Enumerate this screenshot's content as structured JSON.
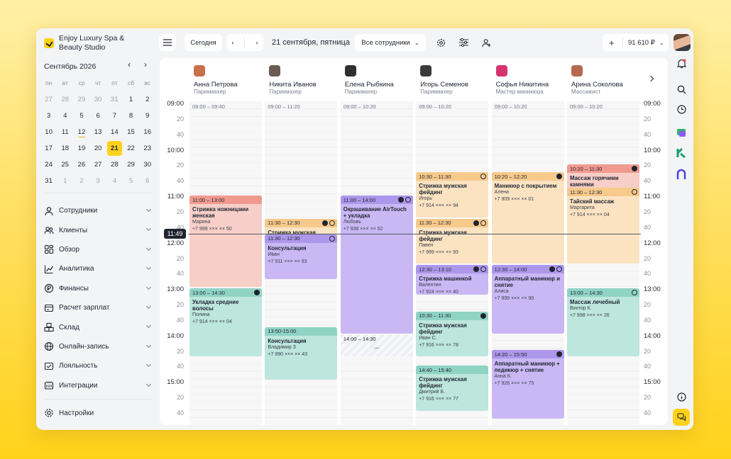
{
  "brand": {
    "name": "Enjoy Luxury Spa & Beauty Studio"
  },
  "mini_calendar": {
    "month_label": "Сентябрь 2026",
    "weekdays": [
      "пн",
      "вт",
      "ср",
      "чт",
      "пт",
      "сб",
      "вс"
    ],
    "days": [
      {
        "d": "27",
        "m": true
      },
      {
        "d": "28",
        "m": true
      },
      {
        "d": "29",
        "m": true
      },
      {
        "d": "30",
        "m": true
      },
      {
        "d": "31",
        "m": true
      },
      {
        "d": "1"
      },
      {
        "d": "2"
      },
      {
        "d": "3"
      },
      {
        "d": "4"
      },
      {
        "d": "5"
      },
      {
        "d": "6"
      },
      {
        "d": "7"
      },
      {
        "d": "8"
      },
      {
        "d": "9"
      },
      {
        "d": "10"
      },
      {
        "d": "11"
      },
      {
        "d": "12",
        "today": true
      },
      {
        "d": "13"
      },
      {
        "d": "14"
      },
      {
        "d": "15"
      },
      {
        "d": "16"
      },
      {
        "d": "17"
      },
      {
        "d": "18"
      },
      {
        "d": "19"
      },
      {
        "d": "20"
      },
      {
        "d": "21",
        "sel": true
      },
      {
        "d": "22"
      },
      {
        "d": "23"
      },
      {
        "d": "24"
      },
      {
        "d": "25"
      },
      {
        "d": "26"
      },
      {
        "d": "27"
      },
      {
        "d": "28"
      },
      {
        "d": "29"
      },
      {
        "d": "30"
      },
      {
        "d": "31"
      },
      {
        "d": "1",
        "m": true
      },
      {
        "d": "2",
        "m": true
      },
      {
        "d": "3",
        "m": true
      },
      {
        "d": "4",
        "m": true
      },
      {
        "d": "5",
        "m": true
      },
      {
        "d": "6",
        "m": true
      }
    ]
  },
  "nav": [
    {
      "label": "Сотрудники",
      "icon": "user-icon"
    },
    {
      "label": "Клиенты",
      "icon": "users-icon"
    },
    {
      "label": "Обзор",
      "icon": "dashboard-icon"
    },
    {
      "label": "Аналитика",
      "icon": "chart-line-icon"
    },
    {
      "label": "Финансы",
      "icon": "coin-icon"
    },
    {
      "label": "Расчет зарплат",
      "icon": "payroll-icon"
    },
    {
      "label": "Склад",
      "icon": "boxes-icon"
    },
    {
      "label": "Онлайн-запись",
      "icon": "globe-icon"
    },
    {
      "label": "Лояльность",
      "icon": "loyalty-icon"
    },
    {
      "label": "Интеграции",
      "icon": "integrations-icon"
    }
  ],
  "settings_label": "Настройки",
  "toolbar": {
    "today": "Сегодня",
    "date": "21 сентября, пятница",
    "staff_filter": "Все сотрудники",
    "balance": "91 610 ₽"
  },
  "staff": [
    {
      "name": "Анна Петрова",
      "role": "Парикмахер",
      "photo": "#c96f4a"
    },
    {
      "name": "Никита Иванов",
      "role": "Парикмахер",
      "photo": "#6b5a52"
    },
    {
      "name": "Елена Рыбкина",
      "role": "Парикмахер",
      "photo": "#2f2f33"
    },
    {
      "name": "Игорь Семенов",
      "role": "Парикмахер",
      "photo": "#3a3a3a"
    },
    {
      "name": "Софья Никитина",
      "role": "Мастер маникюра",
      "photo": "#d6336c"
    },
    {
      "name": "Арина Соколова",
      "role": "Массажист",
      "photo": "#b56a50"
    }
  ],
  "time_labels": [
    "09:00",
    "20",
    "40",
    "10:00",
    "20",
    "40",
    "11:00",
    "20",
    "40",
    "12:00",
    "20",
    "40",
    "13:00",
    "20",
    "40",
    "14:00",
    "20",
    "40",
    "15:00",
    "20",
    "40"
  ],
  "current_time": "11:49",
  "columns": [
    {
      "free": "09:00 – 09:40",
      "appts": [
        {
          "time": "11:00 – 13:00",
          "title": "Стрижка ножницами женская",
          "client": "Марина",
          "phone": "+7 999 ××× ×× 50",
          "color": "red",
          "start": 660,
          "end": 780,
          "badges": []
        },
        {
          "time": "13:00 – 14:30",
          "title": "Укладка средние волосы",
          "client": "Полина",
          "phone": "+7 914 ××× ×× 04",
          "color": "teal",
          "start": 780,
          "end": 870,
          "badges": [
            "dot"
          ]
        }
      ]
    },
    {
      "free": "09:00 – 11:20",
      "appts": [
        {
          "time": "11:30 – 12:30",
          "title": "Стрижка мужская фейдинг",
          "client": "Валентин",
          "phone": "+7 924 ××× ×× 40",
          "color": "ora",
          "start": 690,
          "end": 750,
          "badges": [
            "dot",
            "web"
          ]
        },
        {
          "time": "11:30 – 12:30",
          "title": "Консультация",
          "client": "Иван",
          "phone": "+7 911 ××× ×× 93",
          "color": "pur",
          "start": 710,
          "end": 770,
          "badges": [
            "web"
          ]
        },
        {
          "time": "13:50-15:00",
          "title": "Консультация",
          "client": "Владимир З",
          "phone": "+7 990 ××× ×× 43",
          "color": "teal",
          "start": 830,
          "end": 900,
          "badges": []
        }
      ]
    },
    {
      "free": "09:00 – 10:20",
      "appts": [
        {
          "time": "11:00 – 14:00",
          "title": "Окрашивание AirTouch + укладка",
          "client": "Любовь",
          "phone": "+7 936 ××× ×× 52",
          "color": "pur",
          "start": 660,
          "end": 840,
          "badges": [
            "dot",
            "web"
          ]
        },
        {
          "time": "14:00 – 14:30",
          "title": "",
          "client": "",
          "phone": "",
          "more": "···",
          "color": "hatch",
          "start": 840,
          "end": 870,
          "badges": []
        }
      ]
    },
    {
      "free": "09:00 – 10:20",
      "appts": [
        {
          "time": "10:30 – 11:30",
          "title": "Стрижка мужская фейдинг",
          "client": "Игорь",
          "phone": "+7 914 ××× ×× 94",
          "color": "ora",
          "start": 630,
          "end": 690,
          "badges": [
            "web"
          ]
        },
        {
          "time": "11:30 – 12:30",
          "title": "Стрижка мужская фейдинг",
          "client": "Павел",
          "phone": "+7 999 ××× ×× 93",
          "color": "ora",
          "start": 690,
          "end": 750,
          "badges": [
            "dot",
            "web"
          ]
        },
        {
          "time": "12:30 – 13:10",
          "title": "Стрижка машинкой",
          "client": "Валентин",
          "phone": "+7 924 ××× ×× 40",
          "color": "pur",
          "start": 750,
          "end": 790,
          "badges": [
            "dot",
            "web"
          ]
        },
        {
          "time": "10:30 – 11:30",
          "title": "Стрижка мужская фейдинг",
          "client": "Иван С.",
          "phone": "+7 916 ××× ×× 78",
          "color": "teal",
          "start": 810,
          "end": 870,
          "badges": [
            "dot"
          ]
        },
        {
          "time": "14:40 – 15:40",
          "title": "Стрижка мужская фейдинг",
          "client": "Дмитрий Б.",
          "phone": "+7 916 ××× ×× 77",
          "color": "teal",
          "start": 880,
          "end": 940,
          "badges": []
        }
      ]
    },
    {
      "free": "09:00 – 10:20",
      "appts": [
        {
          "time": "10:20 – 12:20",
          "title": "Маникюр с покрытием",
          "client": "Алена",
          "phone": "+7 909 ××× ×× 01",
          "color": "ora",
          "start": 630,
          "end": 750,
          "badges": [
            "dot"
          ]
        },
        {
          "time": "12:30 – 14:00",
          "title": "Аппаратный маникюр и снятие",
          "client": "Алиса",
          "phone": "+7 999 ××× ×× 90",
          "color": "pur",
          "start": 750,
          "end": 840,
          "badges": [
            "dot",
            "web"
          ]
        },
        {
          "time": "14:20 – 15:50",
          "title": "Аппаратный маникюр + педикюр + снятие",
          "client": "Анна К.",
          "phone": "+7 926 ××× ×× 75",
          "color": "pur",
          "start": 860,
          "end": 950,
          "badges": [
            "dot"
          ]
        }
      ]
    },
    {
      "free": "09:00 – 10:20",
      "appts": [
        {
          "time": "10:20 – 11:30",
          "title": "Массаж горячими камнями",
          "client": "Вячеслав",
          "phone": "+7 909 ××× ×× 04",
          "color": "red",
          "start": 620,
          "end": 690,
          "badges": [
            "dot"
          ]
        },
        {
          "time": "11:30 – 12:30",
          "title": "Тайский массаж",
          "client": "Маргарита",
          "phone": "+7 914 ××× ×× 04",
          "color": "ora",
          "start": 650,
          "end": 750,
          "badges": [
            "web"
          ]
        },
        {
          "time": "13:00 – 14:30",
          "title": "Массаж лечебный",
          "client": "Виктор К.",
          "phone": "+7 998 ××× ×× 26",
          "color": "teal",
          "start": 780,
          "end": 870,
          "badges": [
            "web"
          ]
        }
      ]
    }
  ],
  "colors": {
    "accent": "#ffd21a",
    "red": "#f09a8e",
    "orange": "#f7c98a",
    "purple": "#ad97ea",
    "teal": "#8fd3c5"
  }
}
